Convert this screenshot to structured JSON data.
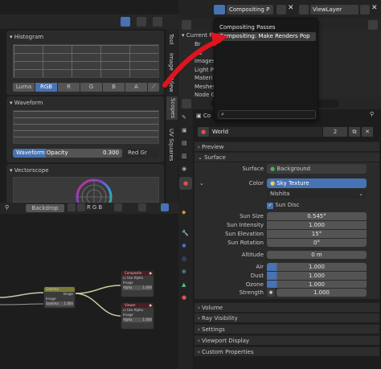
{
  "top_header": {
    "scene_name": "Compositing P",
    "view_layer": "ViewLayer"
  },
  "scopes": {
    "histogram": {
      "title": "Histogram",
      "channels": [
        "Luma",
        "RGB",
        "R",
        "G",
        "B",
        "A"
      ],
      "active": "RGB"
    },
    "waveform": {
      "title": "Waveform",
      "opacity_label": "Waveform Opacity",
      "opacity_value": "0.300",
      "mode": "Red Gr"
    },
    "vectorscope": {
      "title": "Vectorscope"
    },
    "vertical_tabs": [
      "Tool",
      "Image",
      "View",
      "Scopes",
      "UV Squares"
    ]
  },
  "dropdown": {
    "items": [
      "Compositing Passes",
      "Compositing: Make Renders Pop"
    ],
    "highlighted": "Compositing: Make Renders Pop",
    "search_value": ""
  },
  "outliner": {
    "section": "Current File",
    "items": [
      "Br",
      "Ca",
      "Images",
      "Light P",
      "Materi",
      "Meshes",
      "Node G"
    ]
  },
  "properties": {
    "breadcrumb": "Co",
    "world_name": "World",
    "world_users": "2",
    "sections": {
      "preview": "Preview",
      "surface": "Surface",
      "volume": "Volume",
      "ray_visibility": "Ray Visibility",
      "settings": "Settings",
      "viewport_display": "Viewport Display",
      "custom_properties": "Custom Properties"
    },
    "surface_label": "Surface",
    "surface_value": "Background",
    "color_label": "Color",
    "color_value": "Sky Texture",
    "sky_type": "Nishita",
    "sun_disc_label": "Sun Disc",
    "fields": [
      {
        "label": "Sun Size",
        "value": "0.545°"
      },
      {
        "label": "Sun Intensity",
        "value": "1.000"
      },
      {
        "label": "Sun Elevation",
        "value": "15°"
      },
      {
        "label": "Sun Rotation",
        "value": "0°"
      },
      {
        "label": "Altitude",
        "value": "0 m"
      },
      {
        "label": "Air",
        "value": "1.000"
      },
      {
        "label": "Dust",
        "value": "1.000"
      },
      {
        "label": "Ozone",
        "value": "1.000"
      }
    ],
    "strength_label": "Strength",
    "strength_value": "1.000"
  },
  "node_editor": {
    "backdrop_label": "Backdrop",
    "channel_buttons": [
      "R",
      "G",
      "B"
    ],
    "nodes": {
      "composite": {
        "title": "Composite",
        "use_alpha": "Use Alpha",
        "image": "Image",
        "alpha": "Alpha",
        "alpha_val": "1.000"
      },
      "viewer": {
        "title": "Viewer",
        "use_alpha": "Use Alpha",
        "image": "Image",
        "alpha": "Alpha",
        "alpha_val": "1.000"
      },
      "gamma": {
        "title": "Gamma",
        "output": "Image",
        "input": "Image",
        "gamma": "Gamma",
        "gamma_val": "1.000"
      }
    }
  },
  "colors": {
    "accent": "#4772b3",
    "arrow": "#e0141e",
    "node_yellow": "#7a7a35",
    "node_red": "#4a1e22"
  }
}
